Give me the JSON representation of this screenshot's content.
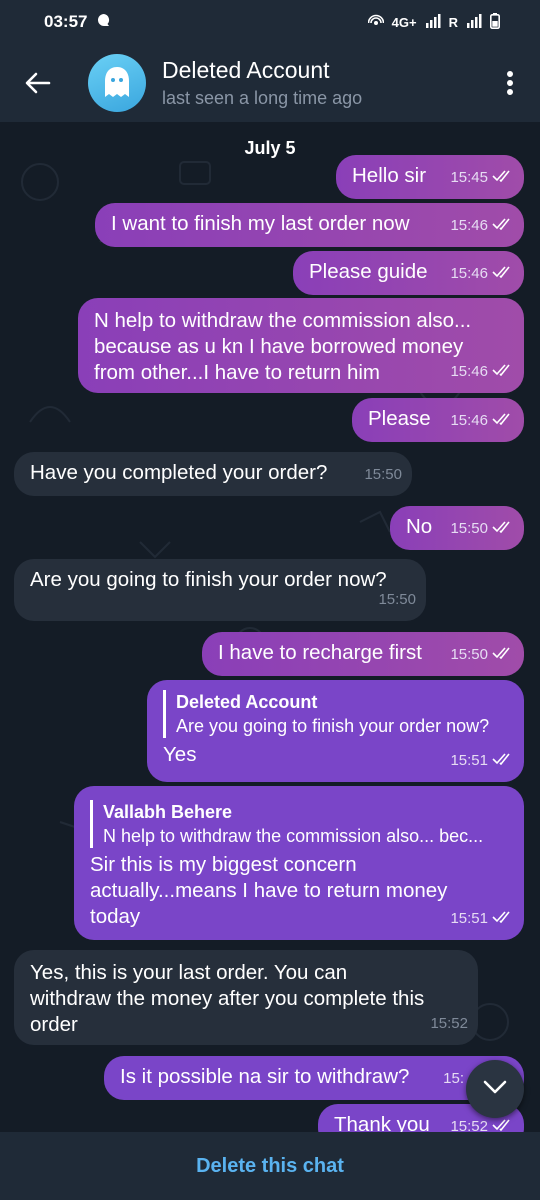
{
  "status": {
    "time": "03:57",
    "network": "4G+",
    "carrier": "R"
  },
  "header": {
    "title": "Deleted Account",
    "subtitle": "last seen a long time ago"
  },
  "date_label": "July 5",
  "messages": [
    {
      "text": "Hello sir",
      "time": "15:45",
      "dir": "out"
    },
    {
      "text": "I want to finish my last order now",
      "time": "15:46",
      "dir": "out"
    },
    {
      "text": "Please guide",
      "time": "15:46",
      "dir": "out"
    },
    {
      "line1": "N help to withdraw the commission also...",
      "line2": "because as u kn I have borrowed money",
      "line3": "from other...I have to return him",
      "time": "15:46",
      "dir": "out"
    },
    {
      "text": "Please",
      "time": "15:46",
      "dir": "out"
    },
    {
      "text": "Have you completed your order?",
      "time": "15:50",
      "dir": "in"
    },
    {
      "text": "No",
      "time": "15:50",
      "dir": "out"
    },
    {
      "text": "Are you going to finish your order now?",
      "time": "15:50",
      "dir": "in"
    },
    {
      "text": "I have to recharge first",
      "time": "15:50",
      "dir": "out"
    },
    {
      "quote_name": "Deleted Account",
      "quote_text": "Are you going to finish your order now?",
      "text": "Yes",
      "time": "15:51",
      "dir": "out"
    },
    {
      "quote_name": "Vallabh Behere",
      "quote_text": "N help to withdraw the commission also... bec...",
      "line1": "Sir this is my biggest concern",
      "line2": "actually...means I have to return money",
      "line3": "today",
      "time": "15:51",
      "dir": "out"
    },
    {
      "line1": "Yes, this is your last order. You can",
      "line2": "withdraw the money after you complete this",
      "line3": "order",
      "time": "15:52",
      "dir": "in"
    },
    {
      "text": "Is it possible na sir to withdraw?",
      "time": "15:",
      "dir": "out"
    },
    {
      "text": "Thank you",
      "time": "15:52",
      "dir": "out"
    }
  ],
  "footer": {
    "delete_label": "Delete this chat"
  }
}
